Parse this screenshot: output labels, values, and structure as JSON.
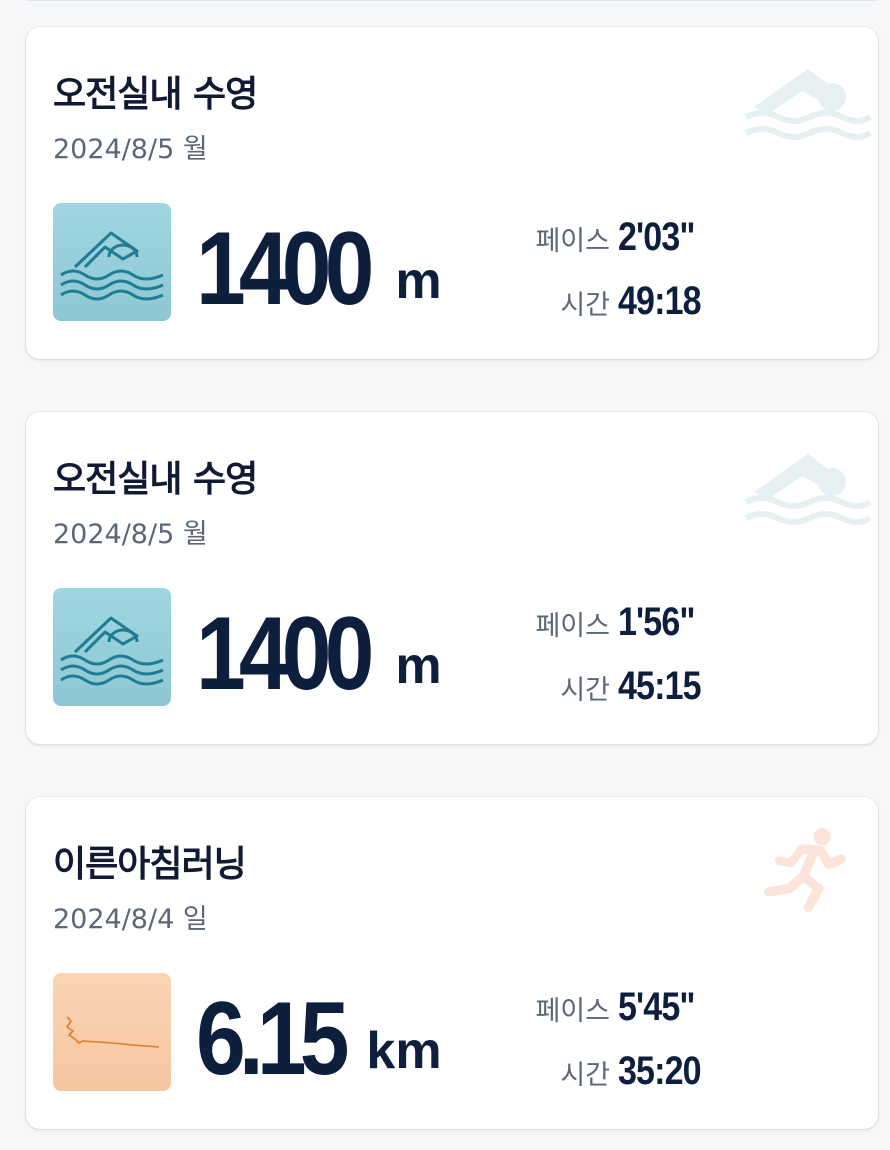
{
  "activities": [
    {
      "title": "오전실내 수영",
      "date": "2024/8/5 월",
      "distance_value": "1400",
      "distance_unit": "m",
      "pace_label": "페이스",
      "pace_value": "2'03\"",
      "time_label": "시간",
      "time_value": "49:18",
      "type_icon": "swimmer-icon",
      "thumbnail": "swim-thumbnail"
    },
    {
      "title": "오전실내 수영",
      "date": "2024/8/5 월",
      "distance_value": "1400",
      "distance_unit": "m",
      "pace_label": "페이스",
      "pace_value": "1'56\"",
      "time_label": "시간",
      "time_value": "45:15",
      "type_icon": "swimmer-icon",
      "thumbnail": "swim-thumbnail"
    },
    {
      "title": "이른아침러닝",
      "date": "2024/8/4 일",
      "distance_value": "6.15",
      "distance_unit": "km",
      "pace_label": "페이스",
      "pace_value": "5'45\"",
      "time_label": "시간",
      "time_value": "35:20",
      "type_icon": "runner-icon",
      "thumbnail": "route-map-thumbnail"
    }
  ],
  "colors": {
    "title": "#101a33",
    "value": "#0e1f3d",
    "muted": "#5b6678",
    "swim_thumb": "#9fd6e1",
    "run_thumb": "#fad4b4",
    "swim_watermark": "#e6eff1",
    "run_watermark": "#fde4d8",
    "route_line": "#e07a2c",
    "swim_line": "#1e7d92"
  }
}
